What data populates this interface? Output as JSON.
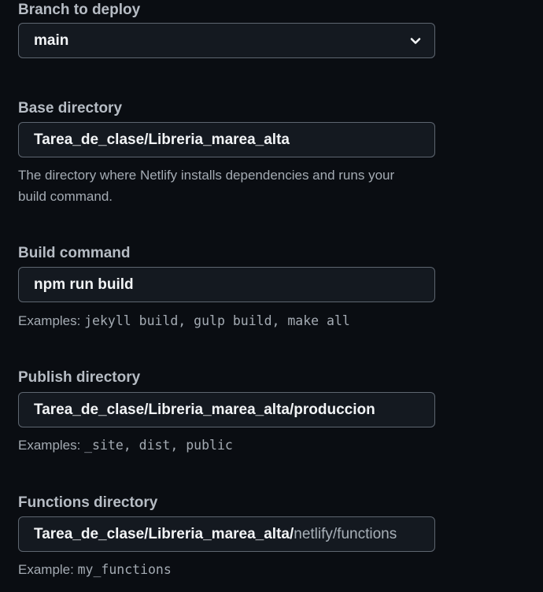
{
  "branch": {
    "label": "Branch to deploy",
    "selected": "main"
  },
  "base_directory": {
    "label": "Base directory",
    "value": "Tarea_de_clase/Libreria_marea_alta",
    "help_line1": "The directory where Netlify installs dependencies and runs your",
    "help_line2": "build command."
  },
  "build_command": {
    "label": "Build command",
    "value": "npm run build",
    "examples_prefix": "Examples: ",
    "examples": "jekyll build, gulp build, make all"
  },
  "publish_directory": {
    "label": "Publish directory",
    "value": "Tarea_de_clase/Libreria_marea_alta/produccion",
    "examples_prefix": "Examples: ",
    "examples": "_site, dist, public"
  },
  "functions_directory": {
    "label": "Functions directory",
    "value": "Tarea_de_clase/Libreria_marea_alta/",
    "value_placeholder_tail": "netlify/functions",
    "example_prefix": "Example: ",
    "example": "my_functions"
  },
  "colors": {
    "background": "#0a0d12",
    "input_background": "#141920",
    "input_border": "#5e6670",
    "label": "#b6bcc4",
    "help_text": "#a4abb3"
  },
  "icons": {
    "select_arrow": "chevron-down-icon"
  }
}
